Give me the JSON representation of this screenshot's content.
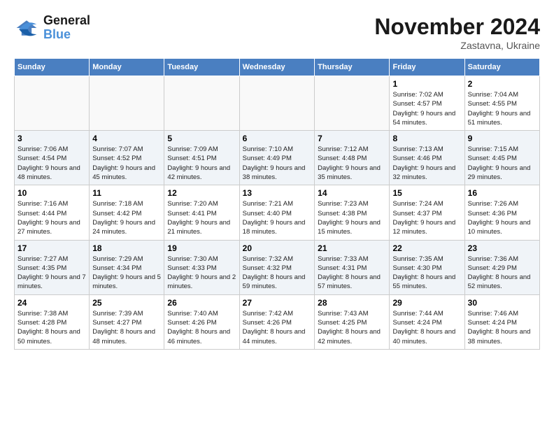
{
  "logo": {
    "line1": "General",
    "line2": "Blue"
  },
  "title": "November 2024",
  "location": "Zastavna, Ukraine",
  "days_of_week": [
    "Sunday",
    "Monday",
    "Tuesday",
    "Wednesday",
    "Thursday",
    "Friday",
    "Saturday"
  ],
  "weeks": [
    [
      {
        "day": "",
        "info": ""
      },
      {
        "day": "",
        "info": ""
      },
      {
        "day": "",
        "info": ""
      },
      {
        "day": "",
        "info": ""
      },
      {
        "day": "",
        "info": ""
      },
      {
        "day": "1",
        "info": "Sunrise: 7:02 AM\nSunset: 4:57 PM\nDaylight: 9 hours and 54 minutes."
      },
      {
        "day": "2",
        "info": "Sunrise: 7:04 AM\nSunset: 4:55 PM\nDaylight: 9 hours and 51 minutes."
      }
    ],
    [
      {
        "day": "3",
        "info": "Sunrise: 7:06 AM\nSunset: 4:54 PM\nDaylight: 9 hours and 48 minutes."
      },
      {
        "day": "4",
        "info": "Sunrise: 7:07 AM\nSunset: 4:52 PM\nDaylight: 9 hours and 45 minutes."
      },
      {
        "day": "5",
        "info": "Sunrise: 7:09 AM\nSunset: 4:51 PM\nDaylight: 9 hours and 42 minutes."
      },
      {
        "day": "6",
        "info": "Sunrise: 7:10 AM\nSunset: 4:49 PM\nDaylight: 9 hours and 38 minutes."
      },
      {
        "day": "7",
        "info": "Sunrise: 7:12 AM\nSunset: 4:48 PM\nDaylight: 9 hours and 35 minutes."
      },
      {
        "day": "8",
        "info": "Sunrise: 7:13 AM\nSunset: 4:46 PM\nDaylight: 9 hours and 32 minutes."
      },
      {
        "day": "9",
        "info": "Sunrise: 7:15 AM\nSunset: 4:45 PM\nDaylight: 9 hours and 29 minutes."
      }
    ],
    [
      {
        "day": "10",
        "info": "Sunrise: 7:16 AM\nSunset: 4:44 PM\nDaylight: 9 hours and 27 minutes."
      },
      {
        "day": "11",
        "info": "Sunrise: 7:18 AM\nSunset: 4:42 PM\nDaylight: 9 hours and 24 minutes."
      },
      {
        "day": "12",
        "info": "Sunrise: 7:20 AM\nSunset: 4:41 PM\nDaylight: 9 hours and 21 minutes."
      },
      {
        "day": "13",
        "info": "Sunrise: 7:21 AM\nSunset: 4:40 PM\nDaylight: 9 hours and 18 minutes."
      },
      {
        "day": "14",
        "info": "Sunrise: 7:23 AM\nSunset: 4:38 PM\nDaylight: 9 hours and 15 minutes."
      },
      {
        "day": "15",
        "info": "Sunrise: 7:24 AM\nSunset: 4:37 PM\nDaylight: 9 hours and 12 minutes."
      },
      {
        "day": "16",
        "info": "Sunrise: 7:26 AM\nSunset: 4:36 PM\nDaylight: 9 hours and 10 minutes."
      }
    ],
    [
      {
        "day": "17",
        "info": "Sunrise: 7:27 AM\nSunset: 4:35 PM\nDaylight: 9 hours and 7 minutes."
      },
      {
        "day": "18",
        "info": "Sunrise: 7:29 AM\nSunset: 4:34 PM\nDaylight: 9 hours and 5 minutes."
      },
      {
        "day": "19",
        "info": "Sunrise: 7:30 AM\nSunset: 4:33 PM\nDaylight: 9 hours and 2 minutes."
      },
      {
        "day": "20",
        "info": "Sunrise: 7:32 AM\nSunset: 4:32 PM\nDaylight: 8 hours and 59 minutes."
      },
      {
        "day": "21",
        "info": "Sunrise: 7:33 AM\nSunset: 4:31 PM\nDaylight: 8 hours and 57 minutes."
      },
      {
        "day": "22",
        "info": "Sunrise: 7:35 AM\nSunset: 4:30 PM\nDaylight: 8 hours and 55 minutes."
      },
      {
        "day": "23",
        "info": "Sunrise: 7:36 AM\nSunset: 4:29 PM\nDaylight: 8 hours and 52 minutes."
      }
    ],
    [
      {
        "day": "24",
        "info": "Sunrise: 7:38 AM\nSunset: 4:28 PM\nDaylight: 8 hours and 50 minutes."
      },
      {
        "day": "25",
        "info": "Sunrise: 7:39 AM\nSunset: 4:27 PM\nDaylight: 8 hours and 48 minutes."
      },
      {
        "day": "26",
        "info": "Sunrise: 7:40 AM\nSunset: 4:26 PM\nDaylight: 8 hours and 46 minutes."
      },
      {
        "day": "27",
        "info": "Sunrise: 7:42 AM\nSunset: 4:26 PM\nDaylight: 8 hours and 44 minutes."
      },
      {
        "day": "28",
        "info": "Sunrise: 7:43 AM\nSunset: 4:25 PM\nDaylight: 8 hours and 42 minutes."
      },
      {
        "day": "29",
        "info": "Sunrise: 7:44 AM\nSunset: 4:24 PM\nDaylight: 8 hours and 40 minutes."
      },
      {
        "day": "30",
        "info": "Sunrise: 7:46 AM\nSunset: 4:24 PM\nDaylight: 8 hours and 38 minutes."
      }
    ]
  ]
}
